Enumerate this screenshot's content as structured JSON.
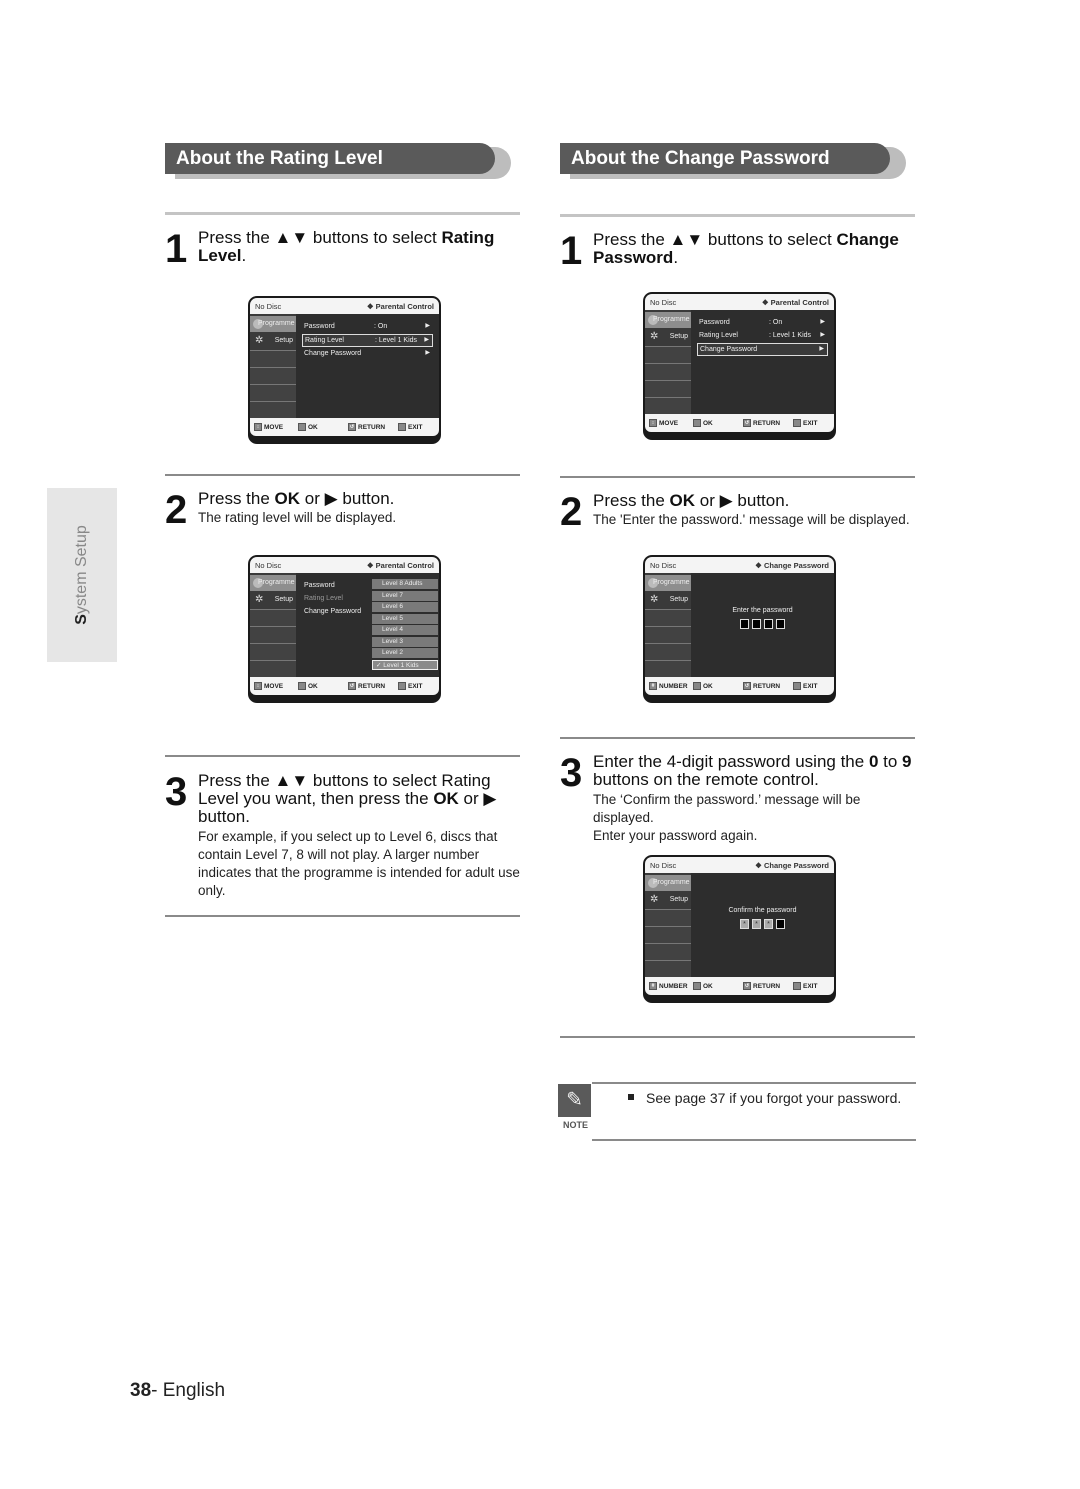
{
  "sidebar": {
    "section_label_first": "S",
    "section_label_rest": "ystem Setup"
  },
  "left": {
    "header": "About the Rating Level",
    "step1": {
      "num": "1",
      "pre": "Press the ▲▼ buttons to select ",
      "bold": "Rating Level",
      "post": "."
    },
    "step2": {
      "num": "2",
      "pre": "Press the ",
      "bold": "OK",
      "post": " or ▶ button.",
      "sub": "The rating level will be displayed."
    },
    "step3": {
      "num": "3",
      "line1": "Press the ▲▼ buttons to select Rating",
      "line2_pre": "Level you want, then press the ",
      "line2_bold": "OK",
      "line2_post": " or ▶",
      "line3": "button.",
      "sub": [
        "For example, if you select up to Level 6, discs that",
        "contain Level 7, 8 will not play. A larger number",
        "indicates that the programme is intended for adult use",
        "only."
      ]
    }
  },
  "right": {
    "header": "About the Change Password",
    "step1": {
      "num": "1",
      "pre": "Press the ▲▼ buttons to select ",
      "bold": "Change Password",
      "post": "."
    },
    "step2": {
      "num": "2",
      "pre": "Press the ",
      "bold": "OK",
      "post": " or ▶ button.",
      "sub": "The 'Enter the password.' message will be displayed."
    },
    "step3": {
      "num": "3",
      "line1_pre": "Enter the 4-digit password using the ",
      "b1": "0",
      "mid": " to ",
      "b2": "9",
      "line2": "buttons on the remote control.",
      "sub": [
        "The ‘Confirm the password.’ message will be displayed.",
        "Enter your password again."
      ]
    }
  },
  "osd": {
    "no_disc": "No Disc",
    "parental_control": "❖ Parental Control",
    "change_password_title": "❖ Change Password",
    "tab_programme": "Programme",
    "tab_setup": "Setup",
    "menu": [
      {
        "label": "Password",
        "value": ": On"
      },
      {
        "label": "Rating Level",
        "value": ": Level 1 Kids"
      },
      {
        "label": "Change Password",
        "value": ""
      }
    ],
    "levels": [
      "Level 8 Adults",
      "Level 7",
      "Level 6",
      "Level 5",
      "Level 4",
      "Level 3",
      "Level 2",
      "✓ Level 1 Kids"
    ],
    "enter_password": "Enter the password",
    "confirm_password": "Confirm the password",
    "confirm_mask": [
      "*",
      "*",
      "*",
      ""
    ],
    "btn_move": "MOVE",
    "btn_number": "NUMBER",
    "btn_ok": "OK",
    "btn_return": "RETURN",
    "btn_exit": "EXIT"
  },
  "note": {
    "label": "NOTE",
    "text": "See page 37 if you forgot your password."
  },
  "footer": {
    "page": "38",
    "lang": "- English"
  }
}
